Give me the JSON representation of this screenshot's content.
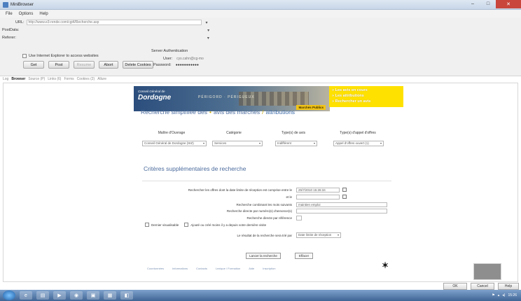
{
  "window": {
    "title": "MiniBrowser"
  },
  "menu": [
    "File",
    "Options",
    "Help"
  ],
  "toolbar": {
    "url_label": "URL:",
    "url_value": "http://www.e3-rende.com/cgi4/Recherche.asp",
    "postdata_label": "PostData:",
    "referer_label": "Referer:",
    "ie_access_label": "Use Internet Explorer to access websites",
    "server_auth_label": "Server Authentication",
    "user_label": "User:",
    "user_value": "cys.cahn@cg-mo",
    "password_label": "Password:",
    "password_value": "●●●●●●●●●●●",
    "buttons": {
      "get": "Get",
      "post": "Post",
      "resume": "Resume",
      "abort": "Abort",
      "delete_cookies": "Delete Cookies"
    }
  },
  "tabs": [
    "Log",
    "Browser",
    "Source (P)",
    "Links (6)",
    "Forms",
    "Cookies (2)",
    "Allure"
  ],
  "page": {
    "banner": {
      "small": "Conseil Général de",
      "brand": "Dordogne",
      "domain": "PÉRIGORD · PÉRIGUEUX",
      "tag": "Marchés Publics"
    },
    "yellow_menu": [
      "Les avis en cours",
      "Les attributions",
      "Rechercher un avis"
    ],
    "breadcrumb": {
      "part1": "Recherche simplifiée des",
      "sep1": "•",
      "part2": "avis des marchés",
      "sep2": "/",
      "part3": "attributions"
    },
    "columns": [
      "Maître d'Ouvrage",
      "Catégorie",
      "Type(s) de avis",
      "Type(s) d'appel d'offres"
    ],
    "selects": [
      "Conseil Général de Dordogne (SIZ)",
      "Services",
      "Indifférent",
      "Appel d'offres ouvert (1)"
    ],
    "criteria_title": "Critères supplémentaires de recherche",
    "criteria": {
      "date_label": "Rechercher les offres dont la date limite de réception est comprise entre le",
      "date_from": "25/7/2010 15:26:34",
      "and_label": "et le",
      "words_label": "Recherche combinant les mots suivants",
      "words_value": "maintien emploi",
      "number_label": "Recherche directe par numéro(s) d'annonce(s)",
      "reference_label": "Recherche directe par référence",
      "check1": "Dernier visualisable",
      "check2": "Ajouté ou créé moins il y a depuis votre dernière visite",
      "sort_label": "Le résultat de la recherche sera trié par",
      "sort_value": "Date limite de réception"
    },
    "actions": {
      "search": "Lancer la recherche",
      "clear": "Effacer"
    },
    "footer_links": [
      "Coordonnées",
      "Informations",
      "Contacts",
      "Lexique / Formation",
      "Aide",
      "Inscription"
    ]
  },
  "dialog": {
    "ok": "OK",
    "cancel": "Cancel",
    "help": "Help"
  },
  "clock": "15:26"
}
